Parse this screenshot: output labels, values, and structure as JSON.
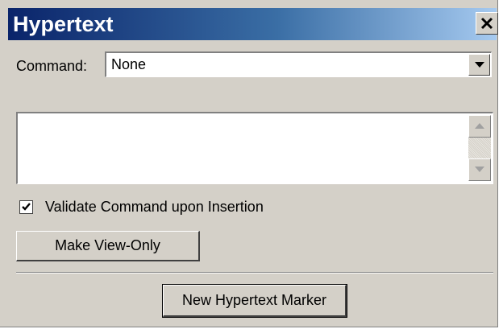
{
  "window": {
    "title": "Hypertext",
    "close_icon": "close-icon"
  },
  "command": {
    "label": "Command:",
    "value": "None",
    "dropdown_icon": "chevron-down-icon"
  },
  "text_area": {
    "value": "",
    "scroll_up_icon": "scroll-up-arrow-icon",
    "scroll_down_icon": "scroll-down-arrow-icon"
  },
  "validate": {
    "label": "Validate Command upon Insertion",
    "checked": true
  },
  "buttons": {
    "make_view_only": "Make View-Only",
    "new_marker": "New Hypertext Marker"
  },
  "colors": {
    "title_gradient_start": "#0a246a",
    "title_gradient_end": "#a6caf0",
    "face": "#d4d0c8"
  }
}
